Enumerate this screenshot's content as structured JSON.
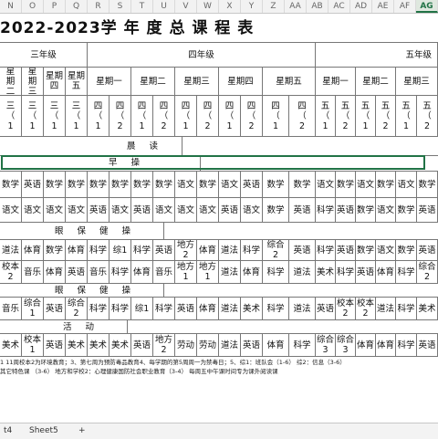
{
  "columns": [
    "N",
    "O",
    "P",
    "Q",
    "R",
    "S",
    "T",
    "U",
    "V",
    "W",
    "X",
    "Y",
    "Z",
    "AA",
    "AB",
    "AC",
    "AD",
    "AE",
    "AF",
    "AG"
  ],
  "title": "2022-2023学  年  度  总  课  程  表",
  "grades": {
    "g3": "三年级",
    "g4": "四年级",
    "g5": "五年级"
  },
  "day_row": [
    "星\n期\n二",
    "星\n期\n三",
    "星期\n四",
    "星期\n五",
    "星期一",
    "星期二",
    "星期三",
    "星期四",
    "星期五",
    "星期一",
    "星期二",
    "星期三"
  ],
  "class_row": [
    "三\n（\n1",
    "三\n（\n1",
    "三\n（\n1",
    "三\n（\n1",
    "四\n（\n1",
    "四\n（\n2",
    "四\n（\n1",
    "四\n（\n2",
    "四\n（\n1",
    "四\n（\n2",
    "四\n（\n1",
    "四\n（\n2",
    "四\n（\n1",
    "四\n（\n2",
    "五\n（\n1",
    "五\n（\n2",
    "五\n（\n1",
    "五\n（\n2",
    "五\n（\n1",
    "五\n（\n2"
  ],
  "label_chendu": "晨  读",
  "label_zaocao": "早  操",
  "label_yanbao1": "眼 保 健 操",
  "label_yanbao2": "眼 保 健 操",
  "label_huodong": "活  动",
  "row1": [
    "数学",
    "英语",
    "数学",
    "数学",
    "数学",
    "数学",
    "数学",
    "数学",
    "语文",
    "数学",
    "语文",
    "英语",
    "数学",
    "数学",
    "语文",
    "数学",
    "语文",
    "数学",
    "语文",
    "数学"
  ],
  "row2": [
    "语文",
    "语文",
    "语文",
    "语文",
    "英语",
    "语文",
    "英语",
    "语文",
    "语文",
    "语文",
    "英语",
    "语文",
    "数学",
    "英语",
    "科学",
    "英语",
    "数学",
    "语文",
    "数学",
    "英语"
  ],
  "row3": [
    "道法",
    "体育",
    "数学",
    "体育",
    "科学",
    "综1",
    "科学",
    "英语",
    "地方2",
    "体育",
    "道法",
    "科学",
    "综合\n2",
    "英语",
    "科学",
    "英语",
    "数学",
    "语文",
    "数学",
    "英语"
  ],
  "row4": [
    "校本\n2",
    "音乐",
    "体育",
    "英语",
    "音乐",
    "科学",
    "体育",
    "音乐",
    "地方\n1",
    "地方\n1",
    "道法",
    "体育",
    "科学",
    "道法",
    "美术",
    "科学",
    "英语",
    "体育",
    "科学",
    "综合\n2"
  ],
  "row5": [
    "音乐",
    "综合\n1",
    "英语",
    "综合\n2",
    "科学",
    "科学",
    "综1",
    "科学",
    "英语",
    "体育",
    "道法",
    "美术",
    "科学",
    "道法",
    "英语",
    "校本\n2",
    "校本2",
    "道法",
    "科学",
    "美术"
  ],
  "row6": [
    "美术",
    "校本\n1",
    "英语",
    "美术",
    "美术",
    "美术",
    "英语",
    "地方\n2",
    "劳动",
    "劳动",
    "道法",
    "英语",
    "体育",
    "科学",
    "综合\n3",
    "综合\n3",
    "体育",
    "体育",
    "科学",
    "英语"
  ],
  "notes_line1": "1 11周校本2为环境教育；3、第七周为预防毒品教育4、每学期的第5周周一为禁毒日；5、综1：班队会（1-6）    综2：信息（3-6）",
  "notes_line2": "其它特色课 （3-6）    地方和学校2：心理健康国防社会职业教育（3-4）     每周五中午课时间专为课外阅读课",
  "tabs": [
    "t4",
    "Sheet5",
    "+"
  ]
}
